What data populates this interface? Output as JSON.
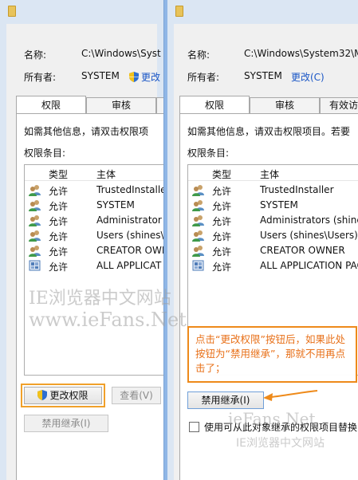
{
  "left_window": {
    "name_label": "名称:",
    "name_value": "C:\\Windows\\Syst",
    "owner_label": "所有者:",
    "owner_value": "SYSTEM",
    "change_link": "更改",
    "tabs": [
      "权限",
      "审核",
      ""
    ],
    "info_text": "如需其他信息，请双击权限项",
    "entries_label": "权限条目:",
    "columns": [
      "类型",
      "主体"
    ],
    "rows": [
      {
        "type": "允许",
        "principal": "TrustedInstaller"
      },
      {
        "type": "允许",
        "principal": "SYSTEM"
      },
      {
        "type": "允许",
        "principal": "Administrator"
      },
      {
        "type": "允许",
        "principal": "Users (shines\\"
      },
      {
        "type": "允许",
        "principal": "CREATOR OWN"
      },
      {
        "type": "允许",
        "principal": "ALL APPLICAT"
      }
    ],
    "change_permissions_button": "更改权限",
    "view_button": "查看(V)",
    "disable_inheritance_button": "禁用继承(I)"
  },
  "right_window": {
    "name_label": "名称:",
    "name_value": "C:\\Windows\\System32\\M",
    "owner_label": "所有者:",
    "owner_value": "SYSTEM",
    "change_link": "更改(C)",
    "tabs": [
      "权限",
      "审核",
      "有效访"
    ],
    "info_text": "如需其他信息，请双击权限项目。若要",
    "entries_label": "权限条目:",
    "columns": [
      "类型",
      "主体"
    ],
    "rows": [
      {
        "type": "允许",
        "principal": "TrustedInstaller"
      },
      {
        "type": "允许",
        "principal": "SYSTEM"
      },
      {
        "type": "允许",
        "principal": "Administrators (shines"
      },
      {
        "type": "允许",
        "principal": "Users (shines\\Users)"
      },
      {
        "type": "允许",
        "principal": "CREATOR OWNER"
      },
      {
        "type": "允许",
        "principal": "ALL APPLICATION PAC"
      }
    ],
    "disable_inheritance_button": "禁用继承(I)",
    "replace_checkbox_label": "使用可从此对象继承的权限项目替换"
  },
  "callout_text": "点击“更改权限”按钮后，如果此处按钮为“禁用继承”，那就不用再点击了；",
  "watermarks": [
    "IE浏览器中文网站",
    "www.ieFans.Net",
    "ieFans.Net",
    "IE浏览器中文网站"
  ],
  "colors": {
    "accent_orange": "#ee8a1a",
    "link_blue": "#1a56c6"
  }
}
